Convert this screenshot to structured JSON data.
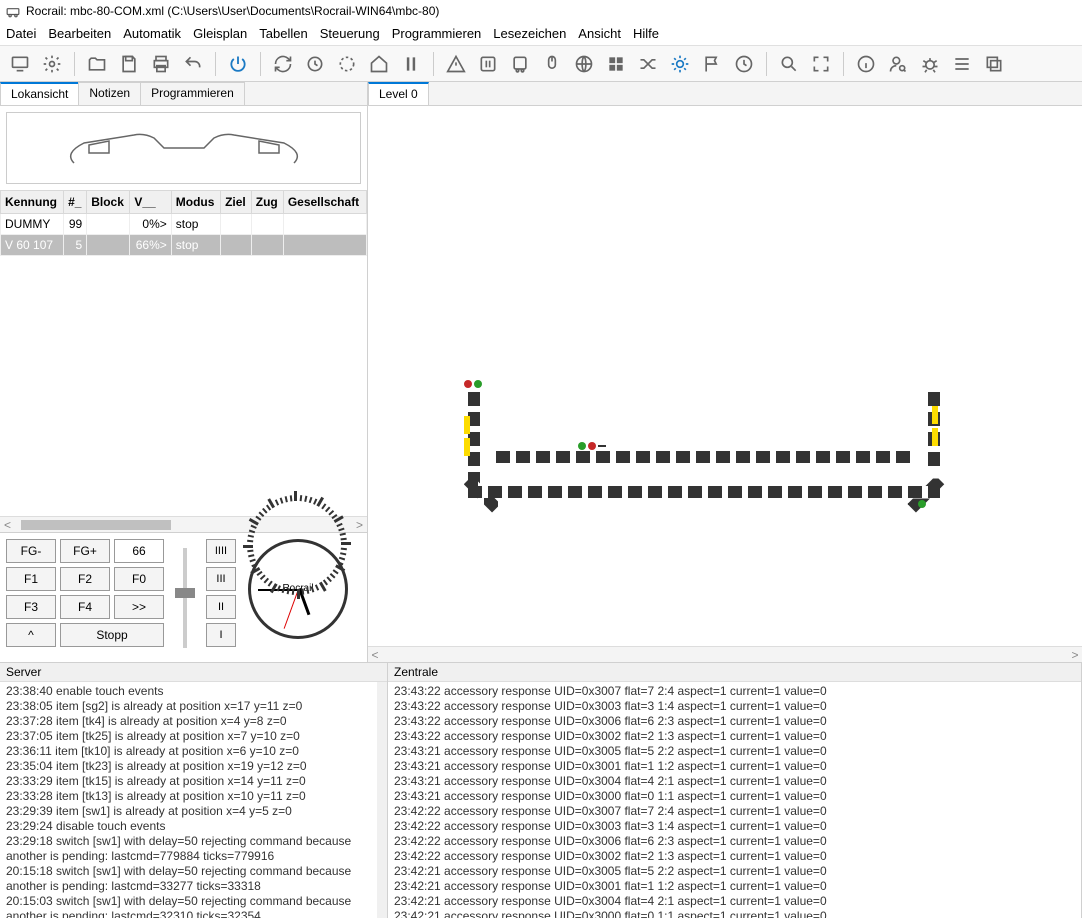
{
  "title": "Rocrail: mbc-80-COM.xml (C:\\Users\\User\\Documents\\Rocrail-WIN64\\mbc-80)",
  "menu": [
    "Datei",
    "Bearbeiten",
    "Automatik",
    "Gleisplan",
    "Tabellen",
    "Steuerung",
    "Programmieren",
    "Lesezeichen",
    "Ansicht",
    "Hilfe"
  ],
  "left_tabs": [
    "Lokansicht",
    "Notizen",
    "Programmieren"
  ],
  "right_tab": "Level 0",
  "table_headers": [
    "Kennung",
    "#_",
    "Block",
    "V__",
    "Modus",
    "Ziel",
    "Zug",
    "Gesellschaft"
  ],
  "rows": [
    {
      "kennung": "DUMMY",
      "num": "99",
      "block": "",
      "v": "0%>",
      "modus": "stop",
      "ziel": "",
      "zug": "",
      "ges": ""
    },
    {
      "kennung": "V 60 107",
      "num": "5",
      "block": "",
      "v": "66%>",
      "modus": "stop",
      "ziel": "",
      "zug": "",
      "ges": ""
    }
  ],
  "control": {
    "fg_minus": "FG-",
    "fg_plus": "FG+",
    "speed": "66",
    "f1": "F1",
    "f2": "F2",
    "f0": "F0",
    "f3": "F3",
    "f4": "F4",
    "dir": ">>",
    "caret": "^",
    "stopp": "Stopp",
    "rom": [
      "IIII",
      "III",
      "II",
      "I"
    ]
  },
  "clock_brand": "Rocrail",
  "server_label": "Server",
  "zentrale_label": "Zentrale",
  "server_log": [
    "23:38:40 enable touch events",
    "23:38:05 item [sg2] is already at position x=17 y=11 z=0",
    "23:37:28 item [tk4] is already at position x=4 y=8 z=0",
    "23:37:05 item [tk25] is already at position x=7 y=10 z=0",
    "23:36:11 item [tk10] is already at position x=6 y=10 z=0",
    "23:35:04 item [tk23] is already at position x=19 y=12 z=0",
    "23:33:29 item [tk15] is already at position x=14 y=11 z=0",
    "23:33:28 item [tk13] is already at position x=10 y=11 z=0",
    "23:29:39 item [sw1] is already at position x=4 y=5 z=0",
    "23:29:24 disable touch events",
    "23:29:18 switch [sw1] with delay=50 rejecting command because another is pending: lastcmd=779884 ticks=779916",
    "20:15:18 switch [sw1] with delay=50 rejecting command because another is pending: lastcmd=33277 ticks=33318",
    "20:15:03 switch [sw1] with delay=50 rejecting command because another is pending: lastcmd=32310 ticks=32354"
  ],
  "zentrale_log": [
    "23:43:22 accessory response UID=0x3007 flat=7 2:4 aspect=1 current=1 value=0",
    "23:43:22 accessory response UID=0x3003 flat=3 1:4 aspect=1 current=1 value=0",
    "23:43:22 accessory response UID=0x3006 flat=6 2:3 aspect=1 current=1 value=0",
    "23:43:22 accessory response UID=0x3002 flat=2 1:3 aspect=1 current=1 value=0",
    "23:43:21 accessory response UID=0x3005 flat=5 2:2 aspect=1 current=1 value=0",
    "23:43:21 accessory response UID=0x3001 flat=1 1:2 aspect=1 current=1 value=0",
    "23:43:21 accessory response UID=0x3004 flat=4 2:1 aspect=1 current=1 value=0",
    "23:43:21 accessory response UID=0x3000 flat=0 1:1 aspect=1 current=1 value=0",
    "23:42:22 accessory response UID=0x3007 flat=7 2:4 aspect=1 current=1 value=0",
    "23:42:22 accessory response UID=0x3003 flat=3 1:4 aspect=1 current=1 value=0",
    "23:42:22 accessory response UID=0x3006 flat=6 2:3 aspect=1 current=1 value=0",
    "23:42:22 accessory response UID=0x3002 flat=2 1:3 aspect=1 current=1 value=0",
    "23:42:21 accessory response UID=0x3005 flat=5 2:2 aspect=1 current=1 value=0",
    "23:42:21 accessory response UID=0x3001 flat=1 1:2 aspect=1 current=1 value=0",
    "23:42:21 accessory response UID=0x3004 flat=4 2:1 aspect=1 current=1 value=0",
    "23:42:21 accessory response UID=0x3000 flat=0 1:1 aspect=1 current=1 value=0"
  ]
}
